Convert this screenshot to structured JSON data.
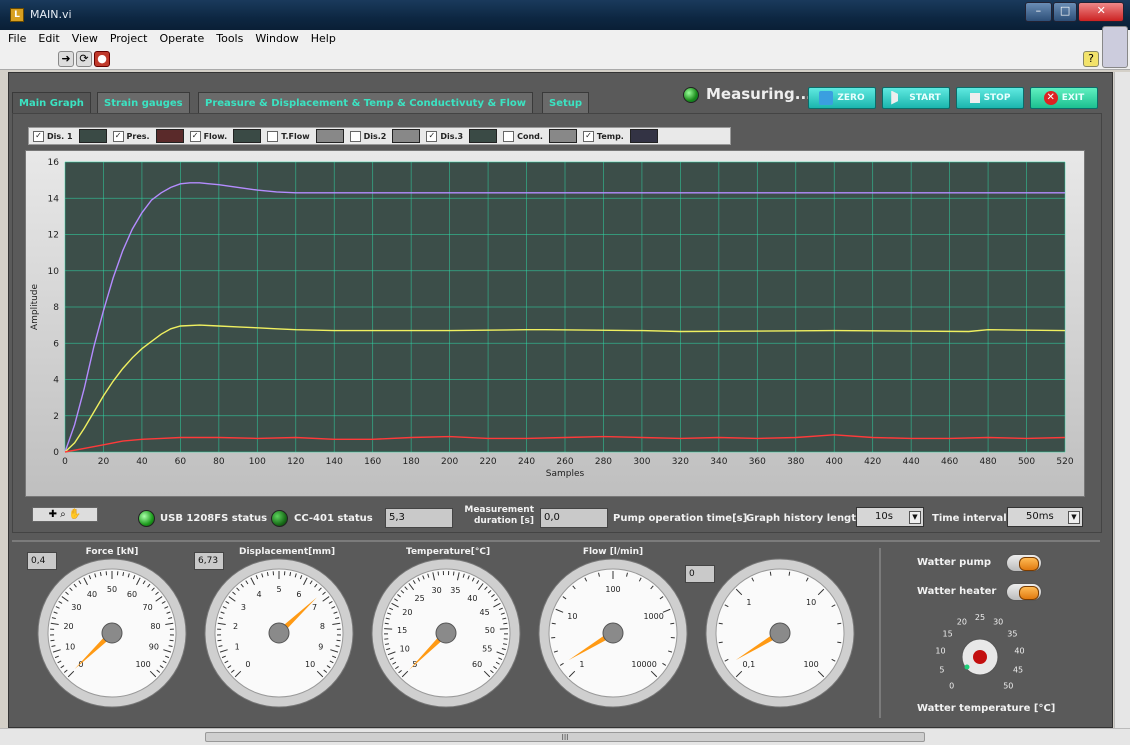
{
  "window": {
    "title": "MAIN.vi"
  },
  "menu": [
    "File",
    "Edit",
    "View",
    "Project",
    "Operate",
    "Tools",
    "Window",
    "Help"
  ],
  "tabs": [
    "Main Graph",
    "Strain gauges",
    "Preasure & Displacement & Temp & Conductivuty & Flow",
    "Setup"
  ],
  "status": {
    "measuring": "Measuring...."
  },
  "controls": {
    "zero": "ZERO",
    "start": "START",
    "stop": "STOP",
    "exit": "EXIT"
  },
  "legend": [
    {
      "label": "Dis. 1",
      "checked": true
    },
    {
      "label": "Pres.",
      "checked": true
    },
    {
      "label": "Flow.",
      "checked": true
    },
    {
      "label": "T.Flow",
      "checked": false
    },
    {
      "label": "Dis.2",
      "checked": false
    },
    {
      "label": "Dis.3",
      "checked": true
    },
    {
      "label": "Cond.",
      "checked": false
    },
    {
      "label": "Temp.",
      "checked": true
    }
  ],
  "chart_data": {
    "type": "line",
    "xlabel": "Samples",
    "ylabel": "Amplitude",
    "xlim": [
      0,
      520
    ],
    "ylim": [
      0,
      16
    ],
    "xticks": [
      0,
      20,
      40,
      60,
      80,
      100,
      120,
      140,
      160,
      180,
      200,
      220,
      240,
      260,
      280,
      300,
      320,
      340,
      360,
      380,
      400,
      420,
      440,
      460,
      480,
      500,
      520
    ],
    "yticks": [
      0,
      2,
      4,
      6,
      8,
      10,
      12,
      14,
      16
    ],
    "grid": true,
    "series": [
      {
        "color": "#b48cff",
        "x": [
          0,
          5,
          10,
          15,
          20,
          25,
          30,
          35,
          40,
          45,
          50,
          55,
          60,
          65,
          70,
          75,
          80,
          90,
          100,
          110,
          120,
          130,
          150,
          200,
          300,
          400,
          520
        ],
        "y": [
          0,
          1.5,
          3.5,
          5.8,
          7.8,
          9.6,
          11.1,
          12.3,
          13.2,
          13.9,
          14.3,
          14.6,
          14.8,
          14.85,
          14.85,
          14.8,
          14.75,
          14.6,
          14.45,
          14.35,
          14.3,
          14.3,
          14.3,
          14.3,
          14.3,
          14.3,
          14.3
        ]
      },
      {
        "color": "#f0f060",
        "x": [
          0,
          5,
          10,
          15,
          20,
          25,
          30,
          35,
          40,
          45,
          50,
          55,
          60,
          70,
          80,
          90,
          100,
          110,
          120,
          140,
          200,
          240,
          250,
          300,
          320,
          400,
          470,
          480,
          520
        ],
        "y": [
          0,
          0.5,
          1.3,
          2.2,
          3.1,
          3.9,
          4.6,
          5.2,
          5.7,
          6.1,
          6.5,
          6.8,
          6.95,
          7.0,
          6.95,
          6.9,
          6.85,
          6.8,
          6.75,
          6.7,
          6.7,
          6.75,
          6.75,
          6.7,
          6.65,
          6.7,
          6.65,
          6.75,
          6.7
        ]
      },
      {
        "color": "#ff3a3a",
        "x": [
          0,
          10,
          20,
          30,
          40,
          50,
          60,
          80,
          100,
          120,
          140,
          160,
          180,
          200,
          220,
          240,
          260,
          280,
          300,
          320,
          340,
          360,
          380,
          400,
          420,
          440,
          460,
          480,
          500,
          520
        ],
        "y": [
          0,
          0.2,
          0.4,
          0.6,
          0.7,
          0.75,
          0.8,
          0.8,
          0.75,
          0.8,
          0.7,
          0.7,
          0.8,
          0.85,
          0.75,
          0.75,
          0.8,
          0.85,
          0.8,
          0.75,
          0.8,
          0.75,
          0.8,
          0.95,
          0.8,
          0.75,
          0.75,
          0.8,
          0.75,
          0.8
        ]
      }
    ]
  },
  "statusbar": {
    "usb_label": "USB 1208FS status",
    "cc_label": "CC-401 status",
    "measurement_value": "5,3",
    "measurement_label": "Measurement duration [s]",
    "pump_value": "0,0",
    "pump_label": "Pump operation time[s]",
    "history_label": "Graph history length",
    "history_value": "10s",
    "interval_label": "Time interval",
    "interval_value": "50ms"
  },
  "gauges": [
    {
      "title": "Force [kN]",
      "value_box": "0,4",
      "labels": [
        "0",
        "10",
        "20",
        "30",
        "40",
        "50",
        "60",
        "70",
        "80",
        "90",
        "100"
      ],
      "min": 0,
      "max": 100,
      "value": 0.4
    },
    {
      "title": "Displacement[mm]",
      "value_box": "6,73",
      "labels": [
        "0",
        "1",
        "2",
        "3",
        "4",
        "5",
        "6",
        "7",
        "8",
        "9",
        "10"
      ],
      "min": 0,
      "max": 10,
      "value": 6.73
    },
    {
      "title": "Temperature[°C]",
      "value_box": "",
      "labels": [
        "5",
        "10",
        "15",
        "20",
        "25",
        "30",
        "35",
        "40",
        "45",
        "50",
        "55",
        "60"
      ],
      "min": 0,
      "max": 60,
      "value": 0
    },
    {
      "title": "Flow [l/min]",
      "value_box": "",
      "labels": [
        "1",
        "10",
        "100",
        "1000",
        "10000"
      ],
      "min": 0,
      "max": 1,
      "value": 0.05
    },
    {
      "title": "",
      "value_box": "0",
      "labels": [
        "0,1",
        "1",
        "10",
        "100"
      ],
      "min": 0,
      "max": 1,
      "value": 0.05
    }
  ],
  "heater_panel": {
    "pump_label": "Watter pump",
    "heater_label": "Watter heater",
    "knob_labels": [
      "0",
      "5",
      "10",
      "15",
      "20",
      "25",
      "30",
      "35",
      "40",
      "45",
      "50"
    ],
    "knob_title": "Watter temperature [°C]"
  },
  "scroll_label": "III"
}
